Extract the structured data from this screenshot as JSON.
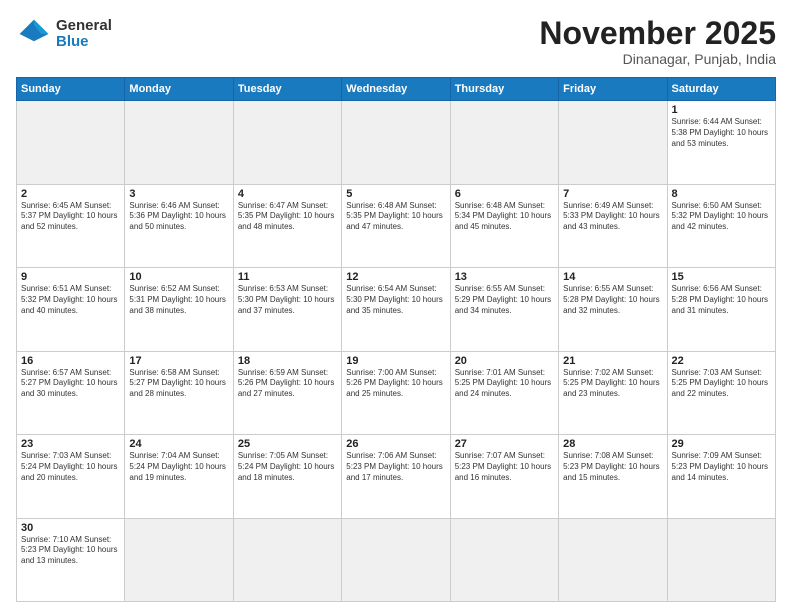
{
  "logo": {
    "general": "General",
    "blue": "Blue"
  },
  "header": {
    "month": "November 2025",
    "location": "Dinanagar, Punjab, India"
  },
  "weekdays": [
    "Sunday",
    "Monday",
    "Tuesday",
    "Wednesday",
    "Thursday",
    "Friday",
    "Saturday"
  ],
  "weeks": [
    [
      {
        "day": null,
        "info": ""
      },
      {
        "day": null,
        "info": ""
      },
      {
        "day": null,
        "info": ""
      },
      {
        "day": null,
        "info": ""
      },
      {
        "day": null,
        "info": ""
      },
      {
        "day": null,
        "info": ""
      },
      {
        "day": "1",
        "info": "Sunrise: 6:44 AM\nSunset: 5:38 PM\nDaylight: 10 hours\nand 53 minutes."
      }
    ],
    [
      {
        "day": "2",
        "info": "Sunrise: 6:45 AM\nSunset: 5:37 PM\nDaylight: 10 hours\nand 52 minutes."
      },
      {
        "day": "3",
        "info": "Sunrise: 6:46 AM\nSunset: 5:36 PM\nDaylight: 10 hours\nand 50 minutes."
      },
      {
        "day": "4",
        "info": "Sunrise: 6:47 AM\nSunset: 5:35 PM\nDaylight: 10 hours\nand 48 minutes."
      },
      {
        "day": "5",
        "info": "Sunrise: 6:48 AM\nSunset: 5:35 PM\nDaylight: 10 hours\nand 47 minutes."
      },
      {
        "day": "6",
        "info": "Sunrise: 6:48 AM\nSunset: 5:34 PM\nDaylight: 10 hours\nand 45 minutes."
      },
      {
        "day": "7",
        "info": "Sunrise: 6:49 AM\nSunset: 5:33 PM\nDaylight: 10 hours\nand 43 minutes."
      },
      {
        "day": "8",
        "info": "Sunrise: 6:50 AM\nSunset: 5:32 PM\nDaylight: 10 hours\nand 42 minutes."
      }
    ],
    [
      {
        "day": "9",
        "info": "Sunrise: 6:51 AM\nSunset: 5:32 PM\nDaylight: 10 hours\nand 40 minutes."
      },
      {
        "day": "10",
        "info": "Sunrise: 6:52 AM\nSunset: 5:31 PM\nDaylight: 10 hours\nand 38 minutes."
      },
      {
        "day": "11",
        "info": "Sunrise: 6:53 AM\nSunset: 5:30 PM\nDaylight: 10 hours\nand 37 minutes."
      },
      {
        "day": "12",
        "info": "Sunrise: 6:54 AM\nSunset: 5:30 PM\nDaylight: 10 hours\nand 35 minutes."
      },
      {
        "day": "13",
        "info": "Sunrise: 6:55 AM\nSunset: 5:29 PM\nDaylight: 10 hours\nand 34 minutes."
      },
      {
        "day": "14",
        "info": "Sunrise: 6:55 AM\nSunset: 5:28 PM\nDaylight: 10 hours\nand 32 minutes."
      },
      {
        "day": "15",
        "info": "Sunrise: 6:56 AM\nSunset: 5:28 PM\nDaylight: 10 hours\nand 31 minutes."
      }
    ],
    [
      {
        "day": "16",
        "info": "Sunrise: 6:57 AM\nSunset: 5:27 PM\nDaylight: 10 hours\nand 30 minutes."
      },
      {
        "day": "17",
        "info": "Sunrise: 6:58 AM\nSunset: 5:27 PM\nDaylight: 10 hours\nand 28 minutes."
      },
      {
        "day": "18",
        "info": "Sunrise: 6:59 AM\nSunset: 5:26 PM\nDaylight: 10 hours\nand 27 minutes."
      },
      {
        "day": "19",
        "info": "Sunrise: 7:00 AM\nSunset: 5:26 PM\nDaylight: 10 hours\nand 25 minutes."
      },
      {
        "day": "20",
        "info": "Sunrise: 7:01 AM\nSunset: 5:25 PM\nDaylight: 10 hours\nand 24 minutes."
      },
      {
        "day": "21",
        "info": "Sunrise: 7:02 AM\nSunset: 5:25 PM\nDaylight: 10 hours\nand 23 minutes."
      },
      {
        "day": "22",
        "info": "Sunrise: 7:03 AM\nSunset: 5:25 PM\nDaylight: 10 hours\nand 22 minutes."
      }
    ],
    [
      {
        "day": "23",
        "info": "Sunrise: 7:03 AM\nSunset: 5:24 PM\nDaylight: 10 hours\nand 20 minutes."
      },
      {
        "day": "24",
        "info": "Sunrise: 7:04 AM\nSunset: 5:24 PM\nDaylight: 10 hours\nand 19 minutes."
      },
      {
        "day": "25",
        "info": "Sunrise: 7:05 AM\nSunset: 5:24 PM\nDaylight: 10 hours\nand 18 minutes."
      },
      {
        "day": "26",
        "info": "Sunrise: 7:06 AM\nSunset: 5:23 PM\nDaylight: 10 hours\nand 17 minutes."
      },
      {
        "day": "27",
        "info": "Sunrise: 7:07 AM\nSunset: 5:23 PM\nDaylight: 10 hours\nand 16 minutes."
      },
      {
        "day": "28",
        "info": "Sunrise: 7:08 AM\nSunset: 5:23 PM\nDaylight: 10 hours\nand 15 minutes."
      },
      {
        "day": "29",
        "info": "Sunrise: 7:09 AM\nSunset: 5:23 PM\nDaylight: 10 hours\nand 14 minutes."
      }
    ],
    [
      {
        "day": "30",
        "info": "Sunrise: 7:10 AM\nSunset: 5:23 PM\nDaylight: 10 hours\nand 13 minutes."
      },
      {
        "day": null,
        "info": ""
      },
      {
        "day": null,
        "info": ""
      },
      {
        "day": null,
        "info": ""
      },
      {
        "day": null,
        "info": ""
      },
      {
        "day": null,
        "info": ""
      },
      {
        "day": null,
        "info": ""
      }
    ]
  ]
}
